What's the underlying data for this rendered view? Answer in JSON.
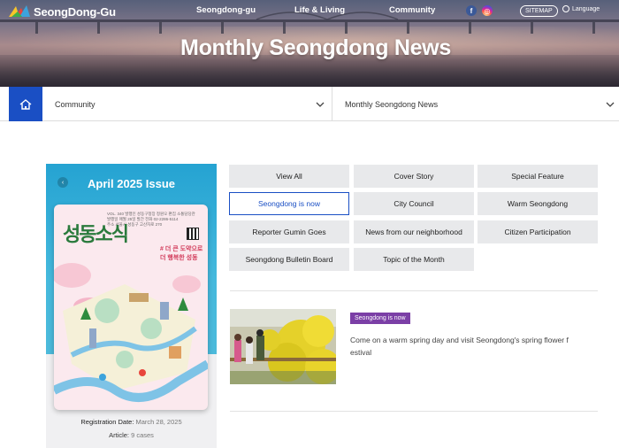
{
  "header": {
    "logo_text": "SeongDong-Gu",
    "nav": [
      "Seongdong-gu",
      "Life & Living",
      "Community"
    ],
    "sitemap_label": "SITEMAP",
    "language_label": "Language",
    "facebook_glyph": "f",
    "instagram_glyph": "◎"
  },
  "hero": {
    "title": "Monthly Seongdong News"
  },
  "breadcrumb": {
    "level1": "Community",
    "level2": "Monthly Seongdong News"
  },
  "issue": {
    "title": "April 2025 Issue",
    "prev_glyph": "‹",
    "cover": {
      "magazine_name": "성동소식",
      "slogan_line1": "# 더 큰 도약으로",
      "slogan_line2": "더 행복한 성동",
      "header_line1": "VOL. 340   발행인 성동구청장 정원오   편집 소통담당관",
      "header_line2": "발행일 매월 25일 발간   전화 02-2286-5114",
      "header_line3": "주소 서울시 성동구 고산자로 270"
    },
    "registration_label": "Registration Date:",
    "registration_date": "March 28, 2025",
    "article_label": "Article:",
    "article_count": "9 cases"
  },
  "categories": [
    "View All",
    "Cover Story",
    "Special Feature",
    "Seongdong is now",
    "City Council",
    "Warm Seongdong",
    "Reporter Gumin Goes",
    "News from our neighborhood",
    "Citizen Participation",
    "Seongdong Bulletin Board",
    "Topic of the Month"
  ],
  "active_category": "Seongdong is now",
  "article": {
    "badge": "Seongdong is now",
    "text": "Come on a warm spring day and visit Seongdong's spring flower festival"
  },
  "colors": {
    "accent": "#1a4fc4",
    "badge": "#7b3fa6",
    "category_bg": "#e8e9eb"
  }
}
